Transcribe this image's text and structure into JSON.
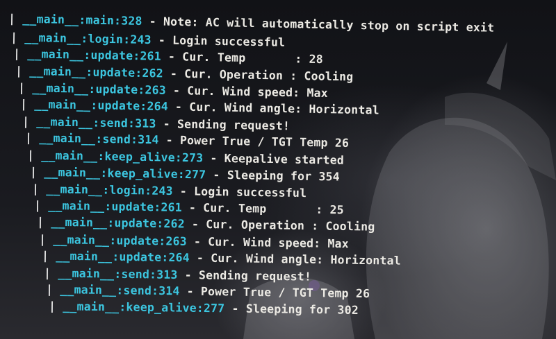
{
  "terminal": {
    "prefix": "|",
    "lines": [
      {
        "module": "__main__:main:328",
        "message": " - Note: AC will automatically stop on script exit"
      },
      {
        "module": "__main__:login:243",
        "message": " - Login successful"
      },
      {
        "module": "__main__:update:261",
        "message": " - Cur. Temp       : 28"
      },
      {
        "module": "__main__:update:262",
        "message": " - Cur. Operation : Cooling"
      },
      {
        "module": "__main__:update:263",
        "message": " - Cur. Wind speed: Max"
      },
      {
        "module": "__main__:update:264",
        "message": " - Cur. Wind angle: Horizontal"
      },
      {
        "module": "__main__:send:313",
        "message": " - Sending request!"
      },
      {
        "module": "__main__:send:314",
        "message": " - Power True / TGT Temp 26"
      },
      {
        "module": "__main__:keep_alive:273",
        "message": " - Keepalive started"
      },
      {
        "module": "__main__:keep_alive:277",
        "message": " - Sleeping for 354"
      },
      {
        "module": "__main__:login:243",
        "message": " - Login successful"
      },
      {
        "module": "__main__:update:261",
        "message": " - Cur. Temp       : 25"
      },
      {
        "module": "__main__:update:262",
        "message": " - Cur. Operation : Cooling"
      },
      {
        "module": "__main__:update:263",
        "message": " - Cur. Wind speed: Max"
      },
      {
        "module": "__main__:update:264",
        "message": " - Cur. Wind angle: Horizontal"
      },
      {
        "module": "__main__:send:313",
        "message": " - Sending request!"
      },
      {
        "module": "__main__:send:314",
        "message": " - Power True / TGT Temp 26"
      },
      {
        "module": "__main__:keep_alive:277",
        "message": " - Sleeping for 302"
      }
    ]
  },
  "colors": {
    "module": "#3cc6e0",
    "text": "#eceae4",
    "background": "#15161a"
  }
}
